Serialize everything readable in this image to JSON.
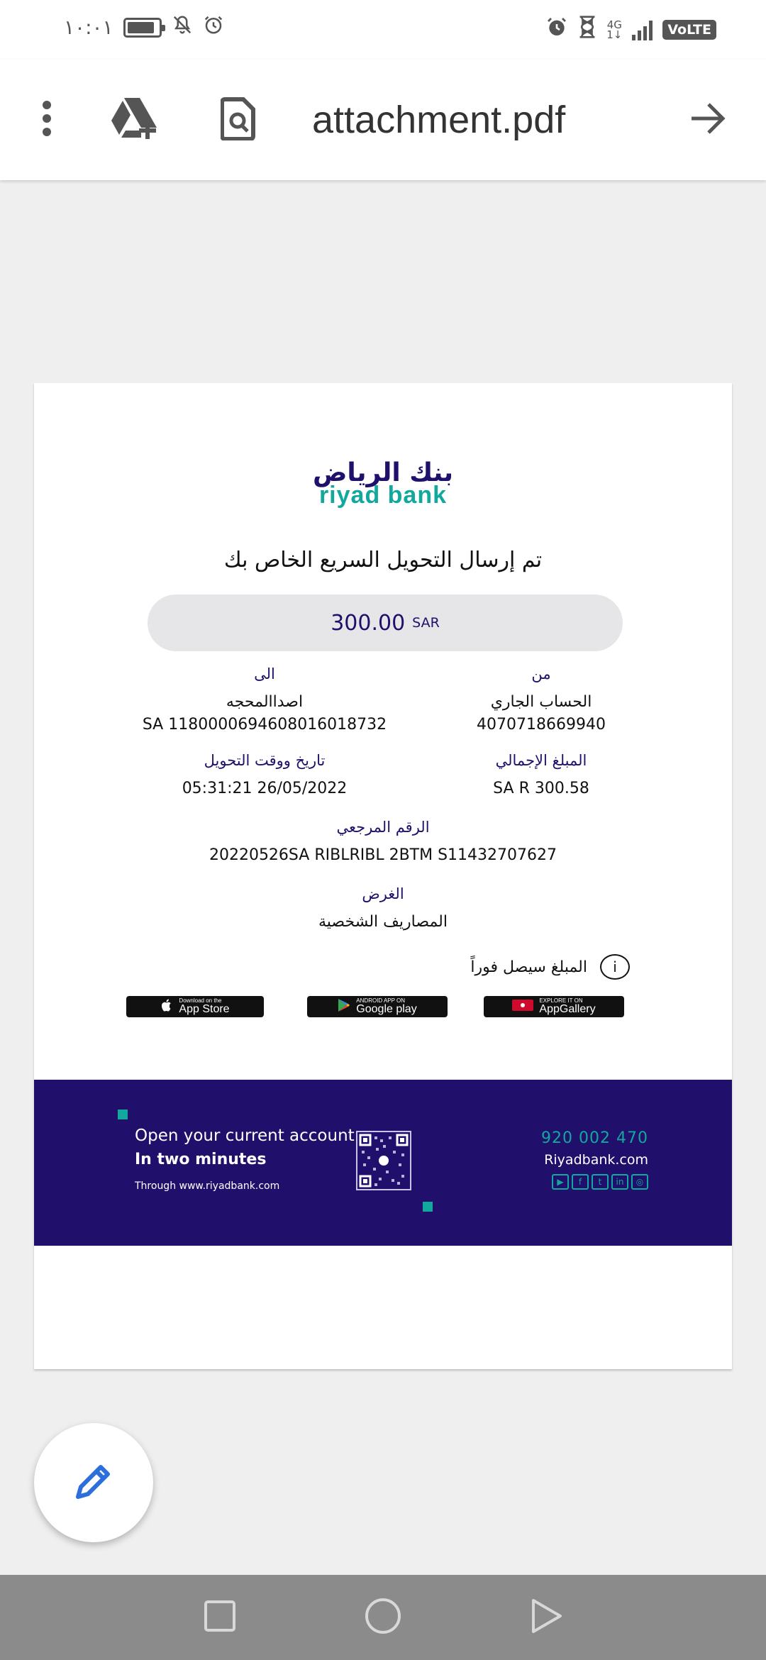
{
  "status_bar": {
    "time": "١٠:٠١",
    "network": "4G",
    "network_sub": "1↓",
    "volte": "VoLTE"
  },
  "toolbar": {
    "title": "attachment.pdf",
    "icons": [
      "more-vert-icon",
      "drive-add-icon",
      "find-in-page-icon",
      "arrow-forward-icon"
    ]
  },
  "receipt": {
    "logo_ar": "بنك الرياض",
    "logo_en": "riyad bank",
    "confirmation": "تم إرسال التحويل السريع الخاص بك",
    "amount": "300.00",
    "amount_currency": "SAR",
    "from_label": "من",
    "from_account_name": "الحساب الجاري",
    "from_account_number": "4070718669940",
    "to_label": "الى",
    "to_name": "اصداالمحجه",
    "to_iban": "SA 1180000694608016018732",
    "total_label": "المبلغ الإجمالي",
    "total_value": "SA R 300.58",
    "datetime_label": "تاريخ ووقت التحويل",
    "datetime_value": "05:31:21 26/05/2022",
    "reference_label": "الرقم المرجعي",
    "reference_value": "20220526SA RIBLRIBL 2BTM S11432707627",
    "purpose_label": "الغرض",
    "purpose_value": "المصاريف الشخصية",
    "notice": "المبلغ سيصل فوراً",
    "notice_icon": "i",
    "stores": [
      {
        "small": "Download on the",
        "big": "App Store",
        "icon": "apple-icon"
      },
      {
        "small": "ANDROID APP ON",
        "big": "Google play",
        "icon": "play-icon"
      },
      {
        "small": "EXPLORE IT ON",
        "big": "AppGallery",
        "icon": "huawei-icon"
      }
    ]
  },
  "banner": {
    "line1": "Open your current account",
    "line2": "In two minutes",
    "line3": "Through www.riyadbank.com",
    "phone": "920 002 470",
    "website": "Riyadbank.com",
    "social_icons": [
      "youtube-icon",
      "facebook-icon",
      "twitter-icon",
      "linkedin-icon",
      "instagram-icon"
    ],
    "social_glyphs": [
      "▶",
      "f",
      "t",
      "in",
      "◎"
    ]
  },
  "colors": {
    "brand_purple": "#20106b",
    "brand_teal": "#13a89e",
    "fab_icon": "#2a6fdb"
  }
}
